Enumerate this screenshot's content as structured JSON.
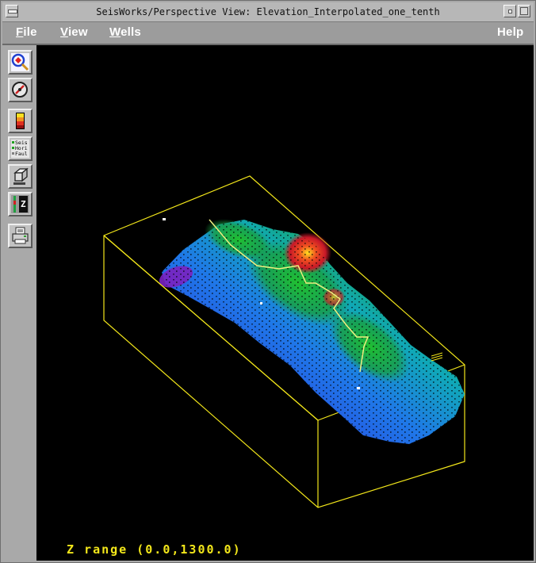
{
  "window": {
    "title": "SeisWorks/Perspective View: Elevation_Interpolated_one_tenth"
  },
  "menubar": {
    "items": [
      {
        "key": "file",
        "label": "File"
      },
      {
        "key": "view",
        "label": "View"
      },
      {
        "key": "wells",
        "label": "Wells"
      }
    ],
    "help_label": "Help"
  },
  "toolbar": {
    "items": [
      {
        "name": "zoom-tool-button",
        "icon": "magnifier-icon"
      },
      {
        "name": "rotate-tool-button",
        "icon": "dial-icon"
      },
      {
        "name": "color-scale-button",
        "icon": "color-bar-icon"
      },
      {
        "name": "display-layers-button",
        "icon": "layers-list-icon"
      },
      {
        "name": "cube-view-button",
        "icon": "cube-icon"
      },
      {
        "name": "z-scale-button",
        "icon": "z-scale-icon"
      },
      {
        "name": "print-button",
        "icon": "printer-icon"
      }
    ],
    "layers_icon_lines": [
      "Seis",
      "Hori",
      "Faul"
    ],
    "z_icon_letter": "Z"
  },
  "viewport": {
    "z_range_label": "Z range (0.0,1300.0)",
    "colors": {
      "background": "#000000",
      "bounding_box": "#f2e61a",
      "surface_low": "#5a1fb0",
      "surface_mid": "#1f6fe0",
      "surface_high": "#1aa83a",
      "surface_peak": "#e0202a",
      "well_path": "#f0f080"
    }
  }
}
